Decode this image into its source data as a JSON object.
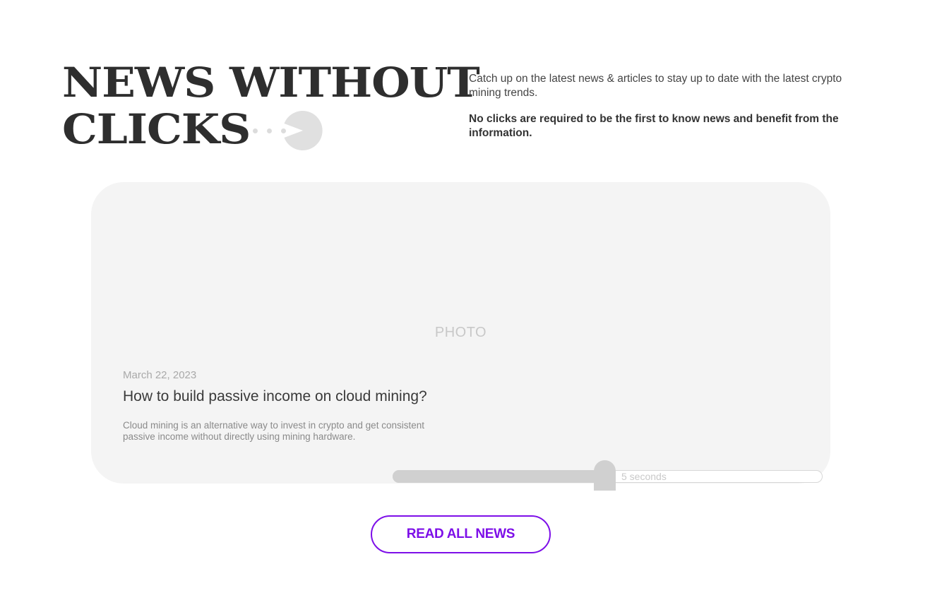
{
  "header": {
    "title_line_1": "NEWS WITHOUT",
    "title_line_2": "CLICKS",
    "intro": "Catch up on the latest news & articles to stay up to date with the latest crypto mining trends.",
    "intro_strong": "No clicks are required to be the first to know news and benefit from the information."
  },
  "featured": {
    "photo_placeholder": "PHOTO",
    "date": "March 22, 2023",
    "title": "How to build passive income on cloud mining?",
    "excerpt": "Cloud mining is an alternative way to invest in crypto and get consistent passive income without directly using mining hardware."
  },
  "timer": {
    "label": "5 seconds",
    "progress": 0.47
  },
  "cta": {
    "label": "READ ALL NEWS"
  },
  "colors": {
    "accent": "#7d0fe8",
    "card_background": "#f4f4f4",
    "placeholder_gray": "#dcdcdc"
  },
  "icons": {
    "decor": "pacman-icon"
  }
}
